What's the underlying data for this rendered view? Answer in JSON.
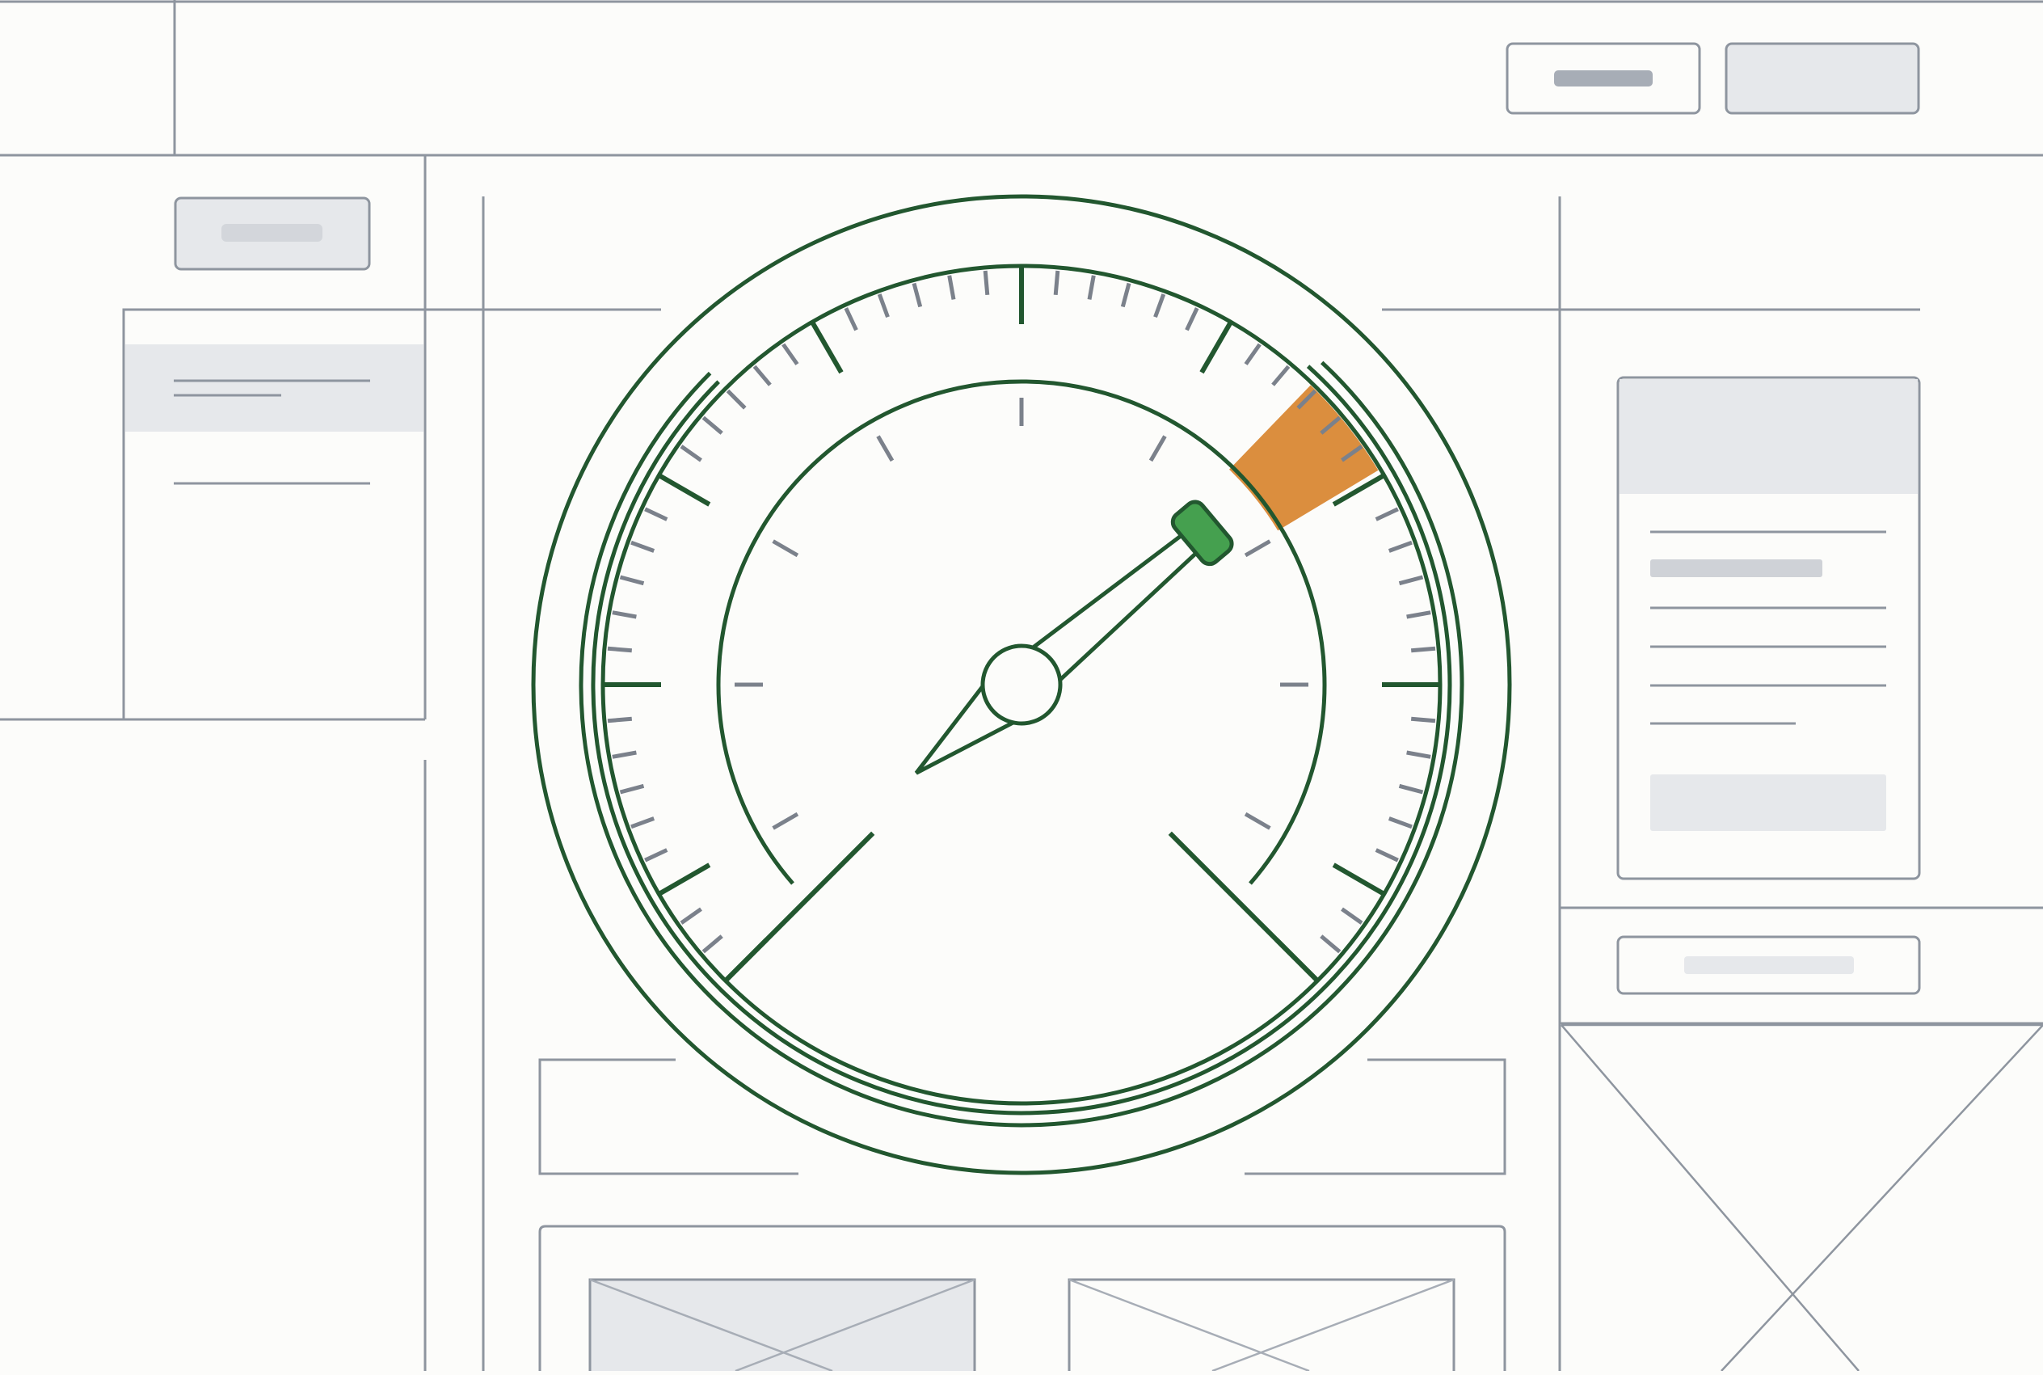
{
  "colors": {
    "background": "#fcfcfa",
    "wireframe_line": "#8e959f",
    "placeholder_fill": "#e6e8eb",
    "placeholder_bar": "#a7adb6",
    "gauge_stroke": "#22572f",
    "needle_tip": "#45a04f",
    "warning_zone": "#db8e3e",
    "minor_tick": "#7b818b"
  },
  "icons": {
    "gauge": "gauge-icon",
    "image_placeholder": "image-placeholder-icon"
  },
  "gauge": {
    "value_fraction": 0.8
  }
}
